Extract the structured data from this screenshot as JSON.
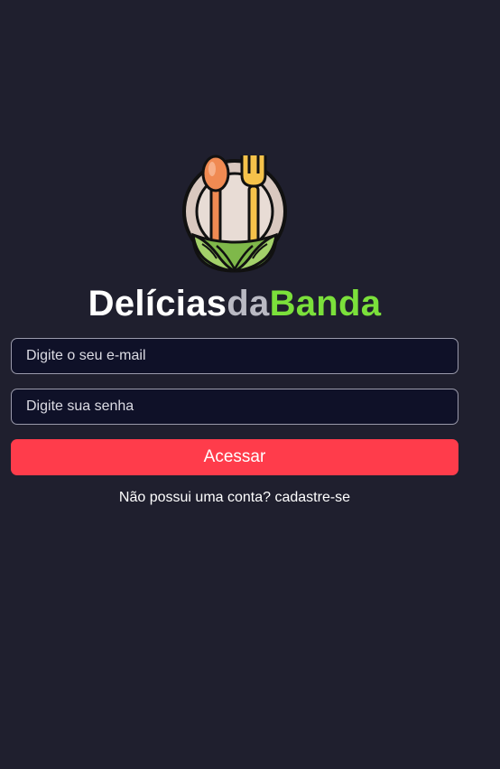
{
  "brand": {
    "part1": "Delícias",
    "part2": "da",
    "part3": "Banda",
    "logo_icon": "plate-spoon-fork-leaves-icon"
  },
  "form": {
    "email_placeholder": "Digite o seu e-mail",
    "password_placeholder": "Digite sua senha",
    "submit_label": "Acessar"
  },
  "signup": {
    "prompt": "Não possui uma conta?",
    "link": "cadastre-se"
  },
  "colors": {
    "background": "#1f1f2e",
    "input_bg": "#0f1128",
    "accent_red": "#ff3c4b",
    "brand_green": "#7be03b",
    "brand_gray": "#b9b9c3"
  }
}
